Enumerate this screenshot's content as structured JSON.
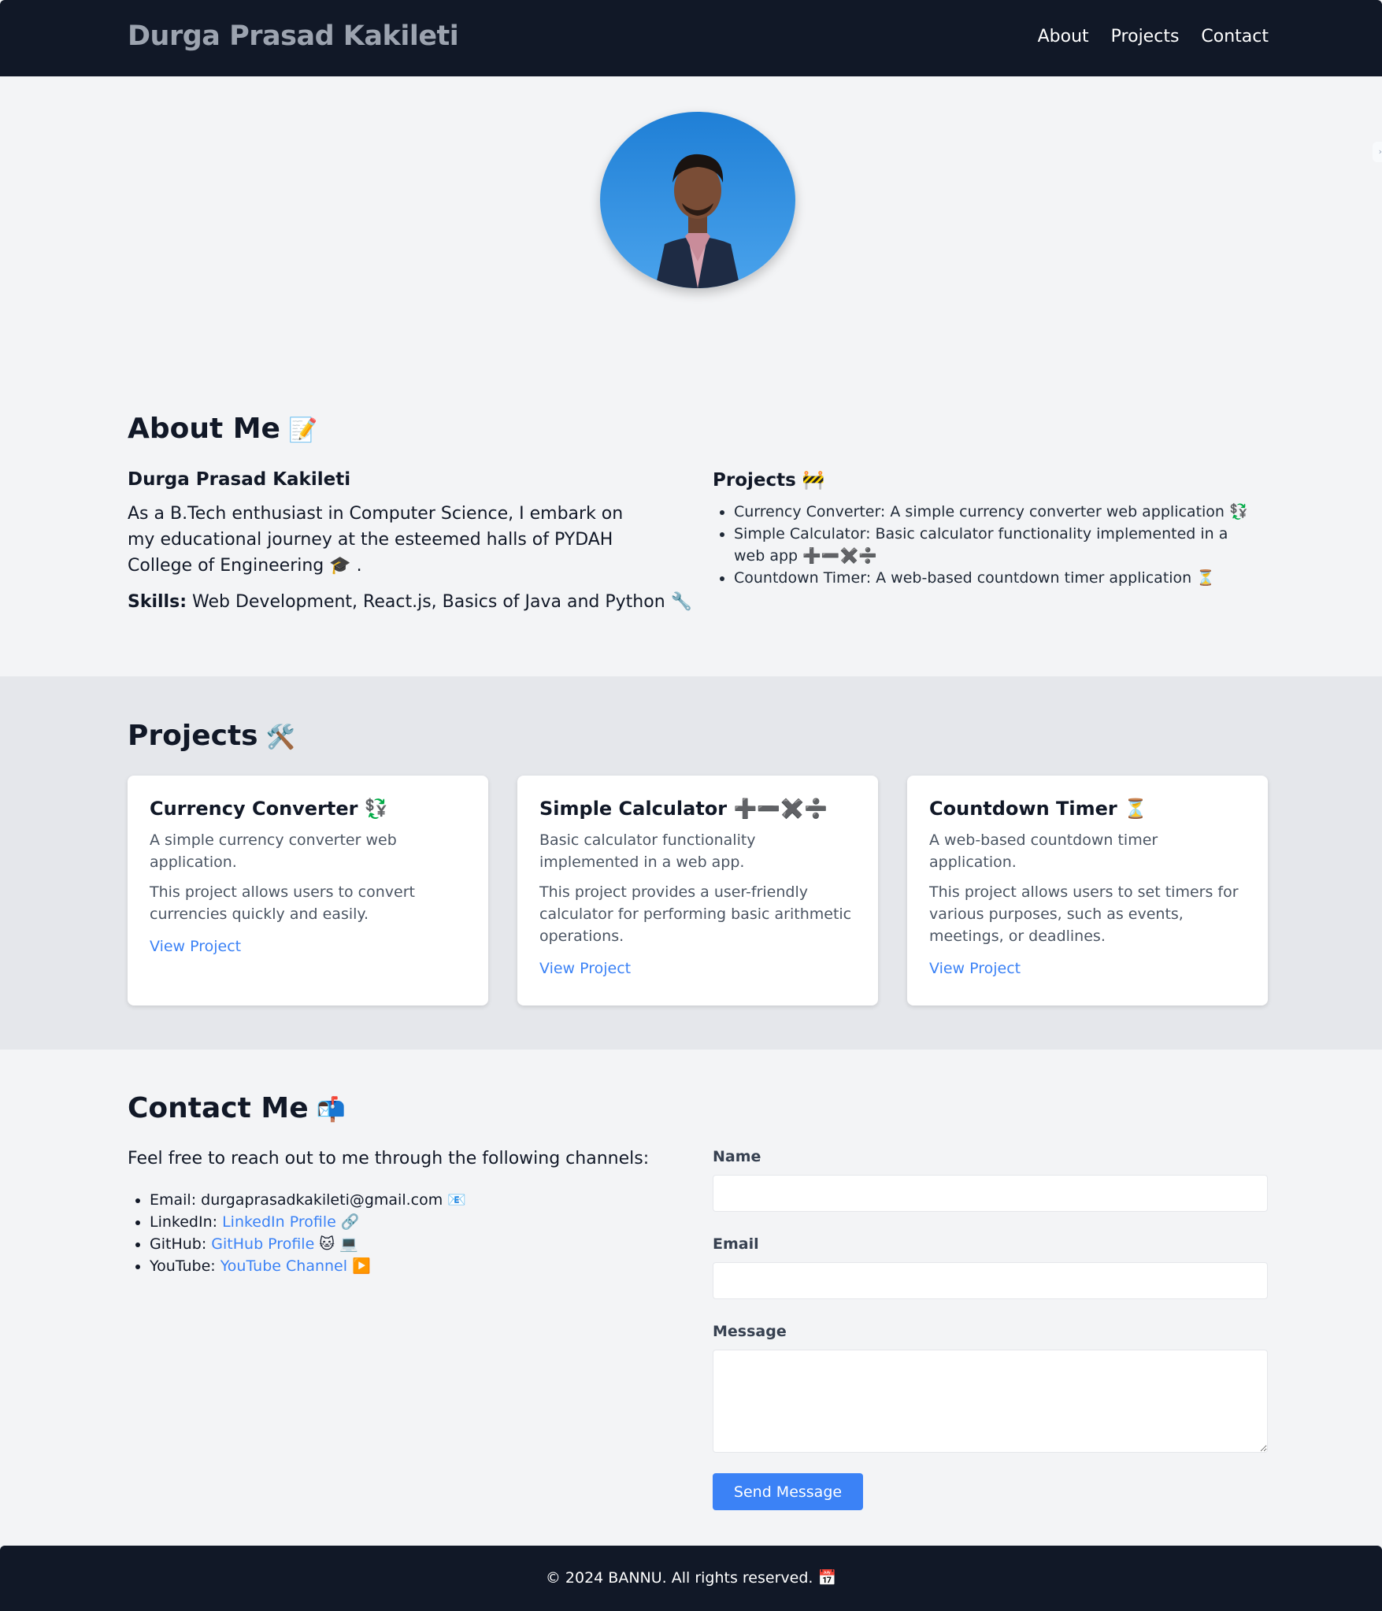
{
  "header": {
    "brand": "Durga Prasad Kakileti",
    "nav": [
      "About",
      "Projects",
      "Contact"
    ]
  },
  "about": {
    "title": "About Me",
    "title_emoji": "📝",
    "name": "Durga Prasad Kakileti",
    "bio": "As a B.Tech enthusiast in Computer Science, I embark on my educational journey at the esteemed halls of PYDAH College of Engineering 🎓 .",
    "skills_label": "Skills:",
    "skills_value": "Web Development, React.js, Basics of Java and Python 🔧",
    "projects_heading": "Projects 🚧",
    "projects_list": [
      "Currency Converter: A simple currency converter web application 💱",
      "Simple Calculator: Basic calculator functionality implemented in a web app ➕➖✖️➗",
      "Countdown Timer: A web-based countdown timer application ⏳"
    ]
  },
  "projects": {
    "title": "Projects",
    "title_emoji": "🛠️",
    "cards": [
      {
        "title": "Currency Converter 💱",
        "summary": "A simple currency converter web application.",
        "detail": "This project allows users to convert currencies quickly and easily.",
        "link": "View Project"
      },
      {
        "title": "Simple Calculator ➕➖✖️➗",
        "summary": "Basic calculator functionality implemented in a web app.",
        "detail": "This project provides a user-friendly calculator for performing basic arithmetic operations.",
        "link": "View Project"
      },
      {
        "title": "Countdown Timer ⏳",
        "summary": "A web-based countdown timer application.",
        "detail": "This project allows users to set timers for various purposes, such as events, meetings, or deadlines.",
        "link": "View Project"
      }
    ]
  },
  "contact": {
    "title": "Contact Me",
    "title_emoji": "📬",
    "intro": "Feel free to reach out to me through the following channels:",
    "email_label": "Email: ",
    "email_value": "durgaprasadkakileti@gmail.com 📧",
    "linkedin_label": "LinkedIn: ",
    "linkedin_link": "LinkedIn Profile",
    "linkedin_emoji": " 🔗",
    "github_label": "GitHub: ",
    "github_link": "GitHub Profile",
    "github_emoji": " 🐱 💻",
    "youtube_label": "YouTube: ",
    "youtube_link": "YouTube Channel",
    "youtube_emoji": " ▶️",
    "form": {
      "name_label": "Name",
      "email_label": "Email",
      "message_label": "Message",
      "name_value": "",
      "email_value": "",
      "message_value": "",
      "submit_label": "Send Message"
    }
  },
  "footer": {
    "text": "© 2024 BANNU. All rights reserved. 📅"
  },
  "colors": {
    "header_bg": "#111827",
    "page_bg": "#f3f4f6",
    "band_bg": "#e5e7eb",
    "accent": "#3b82f6",
    "brand_text": "#9ca3af"
  }
}
